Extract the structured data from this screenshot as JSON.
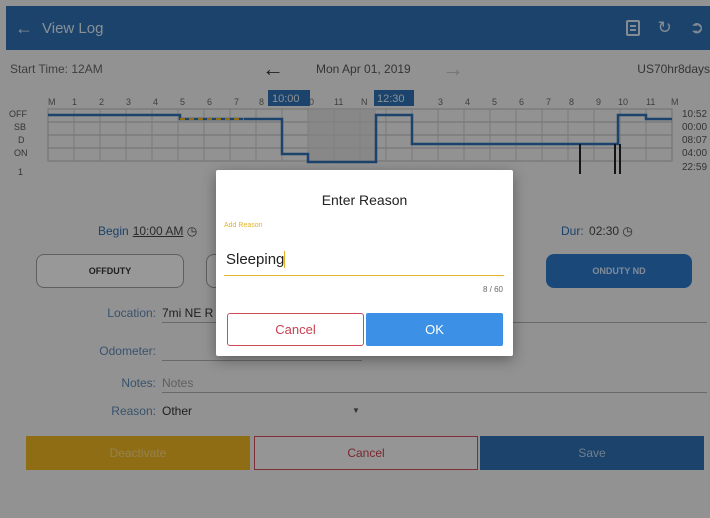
{
  "appbar": {
    "title": "View Log",
    "back_icon": "arrow-left-icon",
    "actions": [
      "print-icon",
      "refresh-icon",
      "logout-icon"
    ]
  },
  "date_nav": {
    "start_time": "Start Time: 12AM",
    "date": "Mon Apr 01, 2019",
    "ruleset": "US70hr8days"
  },
  "graph": {
    "rows": [
      "OFF",
      "SB",
      "D",
      "ON"
    ],
    "hours_top": [
      "M",
      "1",
      "2",
      "3",
      "4",
      "5",
      "6",
      "7",
      "8",
      "9",
      "10",
      "11",
      "N",
      "1",
      "2",
      "3",
      "4",
      "5",
      "6",
      "7",
      "8",
      "9",
      "10",
      "11",
      "M"
    ],
    "selection_start": "10:00",
    "selection_end": "12:30",
    "totals": [
      "10:52",
      "00:00",
      "08:07",
      "04:00",
      "22:59"
    ],
    "row_marker": "1",
    "footer_marks": [
      "1",
      "1"
    ],
    "colors": {
      "line": "#2d6cad",
      "selection": "#2d6cad",
      "dashed": "#e6b021"
    }
  },
  "fields": {
    "begin_label": "Begin",
    "begin_value": "10:00 AM",
    "dur_label": "Dur:",
    "dur_value": "02:30",
    "clock_icon": "clock-icon"
  },
  "status_buttons": {
    "offduty": "OFFDUTY",
    "ondutynd": "ONDUTY ND"
  },
  "form": {
    "location_label": "Location:",
    "location_value": "7mi NE R",
    "odometer_label": "Odometer:",
    "notes_label": "Notes:",
    "notes_placeholder": "Notes",
    "reason_label": "Reason:",
    "reason_value": "Other"
  },
  "actions": {
    "deactivate": "Deactivate",
    "cancel": "Cancel",
    "save": "Save"
  },
  "dialog": {
    "title": "Enter Reason",
    "field_label": "Add Reason",
    "value": "Sleeping",
    "counter": "8 / 60",
    "cancel": "Cancel",
    "ok": "OK"
  }
}
